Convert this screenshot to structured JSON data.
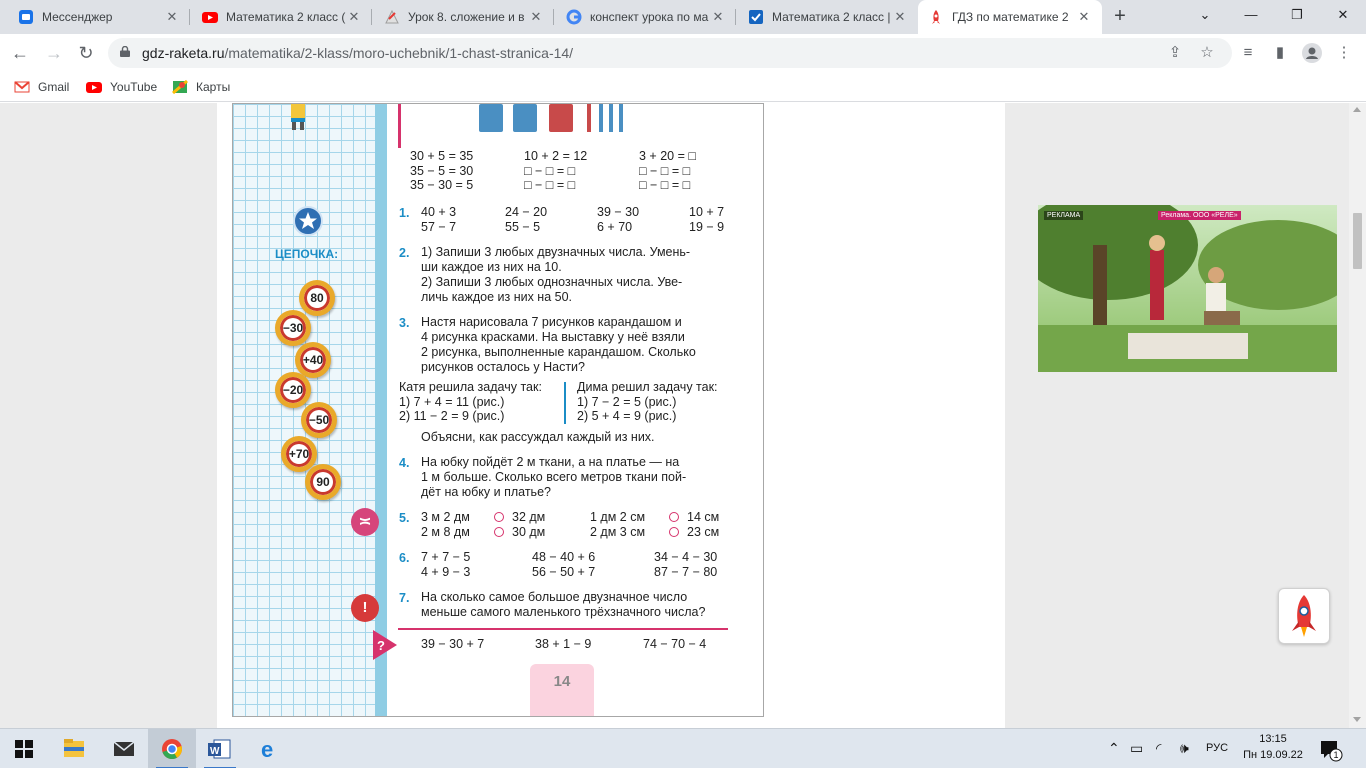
{
  "tabs": [
    {
      "title": "Мессенджер",
      "icon": "messenger-icon",
      "active": false
    },
    {
      "title": "Математика 2 класс (",
      "icon": "youtube-icon",
      "active": false
    },
    {
      "title": "Урок 8. сложение и в",
      "icon": "lesson-icon",
      "active": false
    },
    {
      "title": "конспект урока по ма",
      "icon": "google-icon",
      "active": false
    },
    {
      "title": "Математика 2 класс |",
      "icon": "checkmark-icon",
      "active": false
    },
    {
      "title": "ГДЗ по математике 2",
      "icon": "rocket-icon",
      "active": true
    }
  ],
  "toolbar": {
    "url_host": "gdz-raketa.ru",
    "url_path": "/matematika/2-klass/moro-uchebnik/1-chast-stranica-14/"
  },
  "bookmarks": [
    {
      "label": "Gmail",
      "icon": "gmail-icon"
    },
    {
      "label": "YouTube",
      "icon": "youtube-icon"
    },
    {
      "label": "Карты",
      "icon": "maps-icon"
    }
  ],
  "colors": {
    "accent_blue": "#1b8dc6",
    "accent_pink": "#d6336c",
    "grid_blue": "#a6d6ea"
  },
  "book": {
    "top_examples": [
      [
        "30 + 5 = 35",
        "35 − 5 = 30",
        "35 − 30 = 5"
      ],
      [
        "10 + 2 = 12",
        "□ − □ = □",
        "□ − □ = □"
      ],
      [
        "3 + 20 = □",
        "□ − □ = □",
        "□ − □ = □"
      ]
    ],
    "chain_title": "ЦЕПОЧКА:",
    "chain": [
      "80",
      "−30",
      "+40",
      "−20",
      "−50",
      "+70",
      "90"
    ],
    "task1": {
      "number": "1.",
      "cols": [
        [
          "40 + 3",
          "57 − 7"
        ],
        [
          "24 − 20",
          "55 − 5"
        ],
        [
          "39 − 30",
          "6 + 70"
        ],
        [
          "10 + 7",
          "19 − 9"
        ]
      ]
    },
    "task2": {
      "number": "2.",
      "lines": [
        "1) Запиши 3 любых двузначных числа. Умень-",
        "ши каждое из них на 10.",
        "2) Запиши 3 любых однозначных числа. Уве-",
        "личь каждое из них на 50."
      ]
    },
    "task3": {
      "number": "3.",
      "lines": [
        "Настя нарисовала 7 рисунков карандашом и",
        "4 рисунка красками. На выставку у неё взяли",
        "2 рисунка, выполненные карандашом. Сколько",
        "рисунков осталось у Насти?"
      ],
      "katya": [
        "Катя решила задачу так:",
        "1) 7 + 4 = 11 (рис.)",
        "2) 11 − 2 = 9 (рис.)"
      ],
      "dima": [
        "Дима решил задачу так:",
        "1) 7 − 2 = 5 (рис.)",
        "2) 5 + 4 = 9 (рис.)"
      ],
      "explain": "Объясни, как рассуждал каждый из них."
    },
    "task4": {
      "number": "4.",
      "lines": [
        "На юбку пойдёт 2 м ткани, а на платье — на",
        "1 м больше. Сколько всего метров ткани пой-",
        "дёт на юбку и платье?"
      ]
    },
    "task5": {
      "number": "5.",
      "rows": [
        {
          "a": "3 м 2 дм",
          "b": "32 дм",
          "c": "1 дм 2 см",
          "d": "14 см"
        },
        {
          "a": "2 м 8 дм",
          "b": "30 дм",
          "c": "2 дм 3 см",
          "d": "23 см"
        }
      ]
    },
    "task6": {
      "number": "6.",
      "cols": [
        [
          "7 + 7 − 5",
          "4 + 9 − 3"
        ],
        [
          "48 − 40 + 6",
          "56 − 50 + 7"
        ],
        [
          "34 − 4 − 30",
          "87 − 7 − 80"
        ]
      ]
    },
    "task7": {
      "number": "7.",
      "lines": [
        "На сколько самое большое двузначное число",
        "меньше самого маленького трёхзначного числа?"
      ]
    },
    "bottom": [
      "39 − 30 + 7",
      "38 + 1 − 9",
      "74 − 70 − 4"
    ],
    "page_number": "14"
  },
  "ad": {
    "label": "РЕКЛАМА",
    "brand": "Реклама. ООО «РЕЛЕ»"
  },
  "taskbar": {
    "lang": "РУС",
    "time": "13:15",
    "date": "Пн 19.09.22",
    "notifications": "1"
  }
}
